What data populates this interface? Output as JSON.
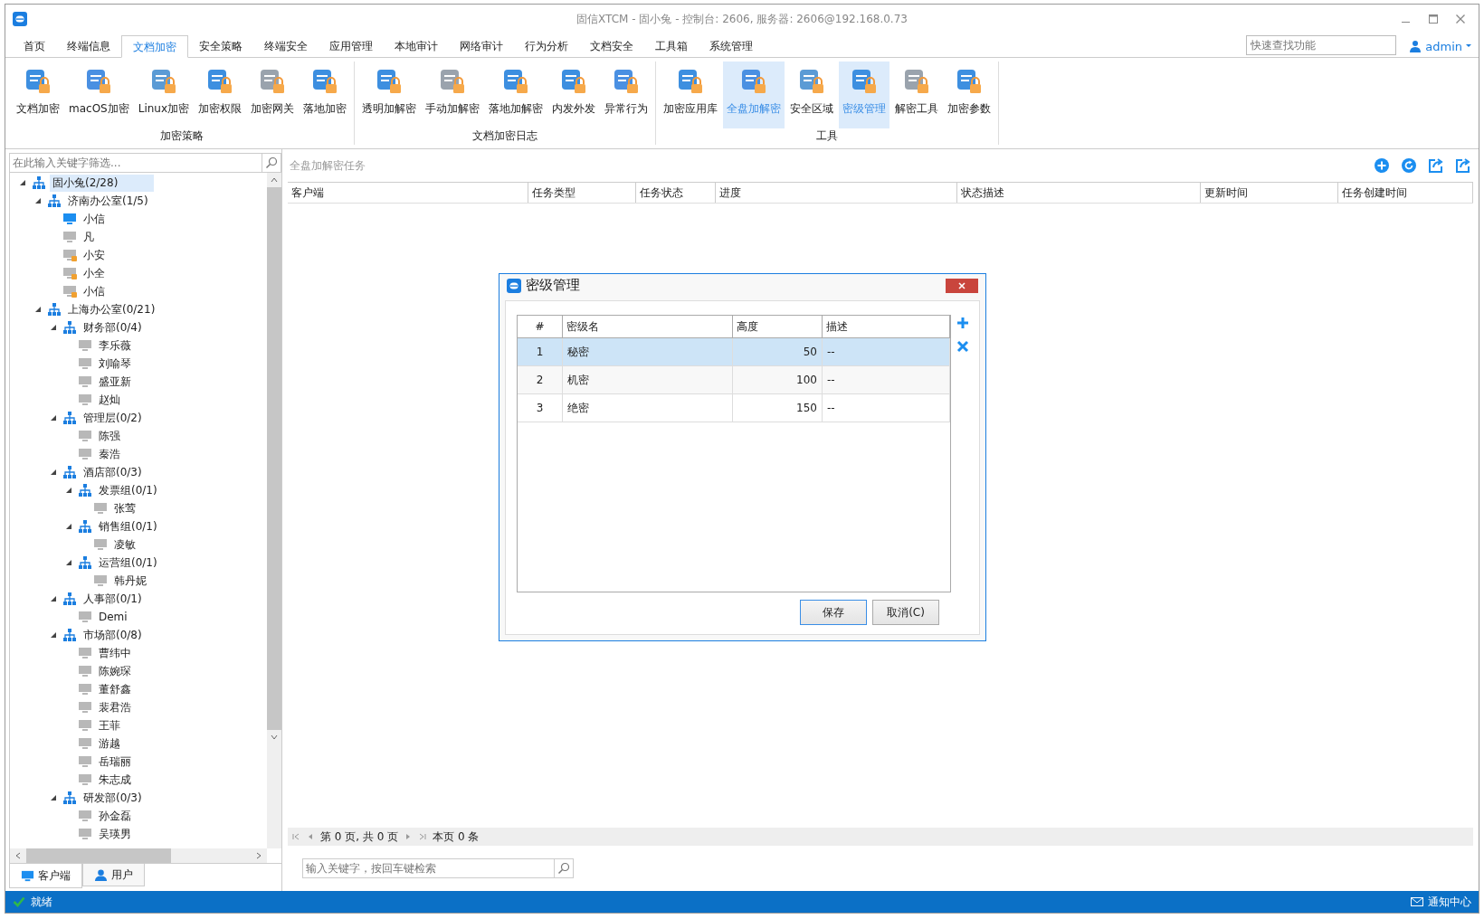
{
  "window": {
    "title": "固信XTCM - 固小兔 - 控制台: 2606, 服务器: 2606@192.168.0.73"
  },
  "menu_tabs": [
    {
      "label": "首页",
      "selected": false
    },
    {
      "label": "终端信息",
      "selected": false
    },
    {
      "label": "文档加密",
      "selected": true
    },
    {
      "label": "安全策略",
      "selected": false
    },
    {
      "label": "终端安全",
      "selected": false
    },
    {
      "label": "应用管理",
      "selected": false
    },
    {
      "label": "本地审计",
      "selected": false
    },
    {
      "label": "网络审计",
      "selected": false
    },
    {
      "label": "行为分析",
      "selected": false
    },
    {
      "label": "文档安全",
      "selected": false
    },
    {
      "label": "工具箱",
      "selected": false
    },
    {
      "label": "系统管理",
      "selected": false
    }
  ],
  "quick_search": {
    "placeholder": "快速查找功能"
  },
  "user": {
    "name": "admin"
  },
  "ribbon_groups": [
    {
      "label": "加密策略",
      "items": [
        {
          "label": "文档加密",
          "selected": false
        },
        {
          "label": "macOS加密",
          "selected": false
        },
        {
          "label": "Linux加密",
          "selected": false
        },
        {
          "label": "加密权限",
          "selected": false
        },
        {
          "label": "加密网关",
          "selected": false
        },
        {
          "label": "落地加密",
          "selected": false
        }
      ]
    },
    {
      "label": "文档加密日志",
      "items": [
        {
          "label": "透明加解密",
          "selected": false
        },
        {
          "label": "手动加解密",
          "selected": false
        },
        {
          "label": "落地加解密",
          "selected": false
        },
        {
          "label": "内发外发",
          "selected": false
        },
        {
          "label": "异常行为",
          "selected": false
        }
      ]
    },
    {
      "label": "工具",
      "items": [
        {
          "label": "加密应用库",
          "selected": false
        },
        {
          "label": "全盘加解密",
          "selected": true
        },
        {
          "label": "安全区域",
          "selected": false
        },
        {
          "label": "密级管理",
          "selected": true
        },
        {
          "label": "解密工具",
          "selected": false
        },
        {
          "label": "加密参数",
          "selected": false
        }
      ]
    }
  ],
  "sidebar": {
    "filter": {
      "placeholder": "在此输入关键字筛选..."
    },
    "tree": [
      {
        "kind": "group",
        "label": "固小兔(2/28)",
        "expanded": true,
        "selected": true,
        "children": [
          {
            "kind": "group",
            "label": "济南办公室(1/5)",
            "expanded": true,
            "selected": false,
            "children": [
              {
                "kind": "client",
                "label": "小信",
                "online": true,
                "locked": false,
                "selected": false
              },
              {
                "kind": "client",
                "label": "凡",
                "online": false,
                "locked": false,
                "selected": false
              },
              {
                "kind": "client",
                "label": "小安",
                "online": false,
                "locked": true,
                "selected": false
              },
              {
                "kind": "client",
                "label": "小全",
                "online": false,
                "locked": true,
                "selected": false
              },
              {
                "kind": "client",
                "label": "小信",
                "online": false,
                "locked": true,
                "selected": false
              }
            ]
          },
          {
            "kind": "group",
            "label": "上海办公室(0/21)",
            "expanded": true,
            "selected": false,
            "children": [
              {
                "kind": "group",
                "label": "财务部(0/4)",
                "expanded": true,
                "selected": false,
                "children": [
                  {
                    "kind": "client",
                    "label": "李乐薇",
                    "online": false,
                    "locked": false,
                    "selected": false
                  },
                  {
                    "kind": "client",
                    "label": "刘喻琴",
                    "online": false,
                    "locked": false,
                    "selected": false
                  },
                  {
                    "kind": "client",
                    "label": "盛亚新",
                    "online": false,
                    "locked": false,
                    "selected": false
                  },
                  {
                    "kind": "client",
                    "label": "赵灿",
                    "online": false,
                    "locked": false,
                    "selected": false
                  }
                ]
              },
              {
                "kind": "group",
                "label": "管理层(0/2)",
                "expanded": true,
                "selected": false,
                "children": [
                  {
                    "kind": "client",
                    "label": "陈强",
                    "online": false,
                    "locked": false,
                    "selected": false
                  },
                  {
                    "kind": "client",
                    "label": "秦浩",
                    "online": false,
                    "locked": false,
                    "selected": false
                  }
                ]
              },
              {
                "kind": "group",
                "label": "酒店部(0/3)",
                "expanded": true,
                "selected": false,
                "children": [
                  {
                    "kind": "group",
                    "label": "发票组(0/1)",
                    "expanded": true,
                    "selected": false,
                    "children": [
                      {
                        "kind": "client",
                        "label": "张莺",
                        "online": false,
                        "locked": false,
                        "selected": false
                      }
                    ]
                  },
                  {
                    "kind": "group",
                    "label": "销售组(0/1)",
                    "expanded": true,
                    "selected": false,
                    "children": [
                      {
                        "kind": "client",
                        "label": "凌敏",
                        "online": false,
                        "locked": false,
                        "selected": false
                      }
                    ]
                  },
                  {
                    "kind": "group",
                    "label": "运营组(0/1)",
                    "expanded": true,
                    "selected": false,
                    "children": [
                      {
                        "kind": "client",
                        "label": "韩丹妮",
                        "online": false,
                        "locked": false,
                        "selected": false
                      }
                    ]
                  }
                ]
              },
              {
                "kind": "group",
                "label": "人事部(0/1)",
                "expanded": true,
                "selected": false,
                "children": [
                  {
                    "kind": "client",
                    "label": "Demi",
                    "online": false,
                    "locked": false,
                    "selected": false
                  }
                ]
              },
              {
                "kind": "group",
                "label": "市场部(0/8)",
                "expanded": true,
                "selected": false,
                "children": [
                  {
                    "kind": "client",
                    "label": "曹纬中",
                    "online": false,
                    "locked": false,
                    "selected": false
                  },
                  {
                    "kind": "client",
                    "label": "陈婉琛",
                    "online": false,
                    "locked": false,
                    "selected": false
                  },
                  {
                    "kind": "client",
                    "label": "董舒鑫",
                    "online": false,
                    "locked": false,
                    "selected": false
                  },
                  {
                    "kind": "client",
                    "label": "裴君浩",
                    "online": false,
                    "locked": false,
                    "selected": false
                  },
                  {
                    "kind": "client",
                    "label": "王菲",
                    "online": false,
                    "locked": false,
                    "selected": false
                  },
                  {
                    "kind": "client",
                    "label": "游越",
                    "online": false,
                    "locked": false,
                    "selected": false
                  },
                  {
                    "kind": "client",
                    "label": "岳瑞丽",
                    "online": false,
                    "locked": false,
                    "selected": false
                  },
                  {
                    "kind": "client",
                    "label": "朱志成",
                    "online": false,
                    "locked": false,
                    "selected": false
                  }
                ]
              },
              {
                "kind": "group",
                "label": "研发部(0/3)",
                "expanded": true,
                "selected": false,
                "children": [
                  {
                    "kind": "client",
                    "label": "孙金磊",
                    "online": false,
                    "locked": false,
                    "selected": false
                  },
                  {
                    "kind": "client",
                    "label": "吴瑛男",
                    "online": false,
                    "locked": false,
                    "selected": false
                  }
                ]
              }
            ]
          }
        ]
      }
    ],
    "tabs": [
      {
        "label": "客户端",
        "selected": true
      },
      {
        "label": "用户",
        "selected": false
      }
    ]
  },
  "main": {
    "title": "全盘加解密任务",
    "table": {
      "columns": [
        "客户端",
        "任务类型",
        "任务状态",
        "进度",
        "状态描述",
        "更新时间",
        "任务创建时间"
      ]
    },
    "pager": {
      "page_info": "第 0 页, 共 0 页",
      "row_info": "本页 0 条"
    },
    "search": {
      "placeholder": "输入关键字，按回车键检索"
    }
  },
  "dialog": {
    "title": "密级管理",
    "table": {
      "columns": [
        "#",
        "密级名",
        "高度",
        "描述"
      ],
      "rows": [
        {
          "cells": [
            "1",
            "秘密",
            "50",
            "--"
          ],
          "selected": true
        },
        {
          "cells": [
            "2",
            "机密",
            "100",
            "--"
          ],
          "selected": false
        },
        {
          "cells": [
            "3",
            "绝密",
            "150",
            "--"
          ],
          "selected": false
        }
      ]
    },
    "buttons": [
      {
        "label": "保存",
        "default": true
      },
      {
        "label": "取消(C)",
        "default": false
      }
    ]
  },
  "status_bar": {
    "text": "就绪",
    "notice": "通知中心"
  }
}
